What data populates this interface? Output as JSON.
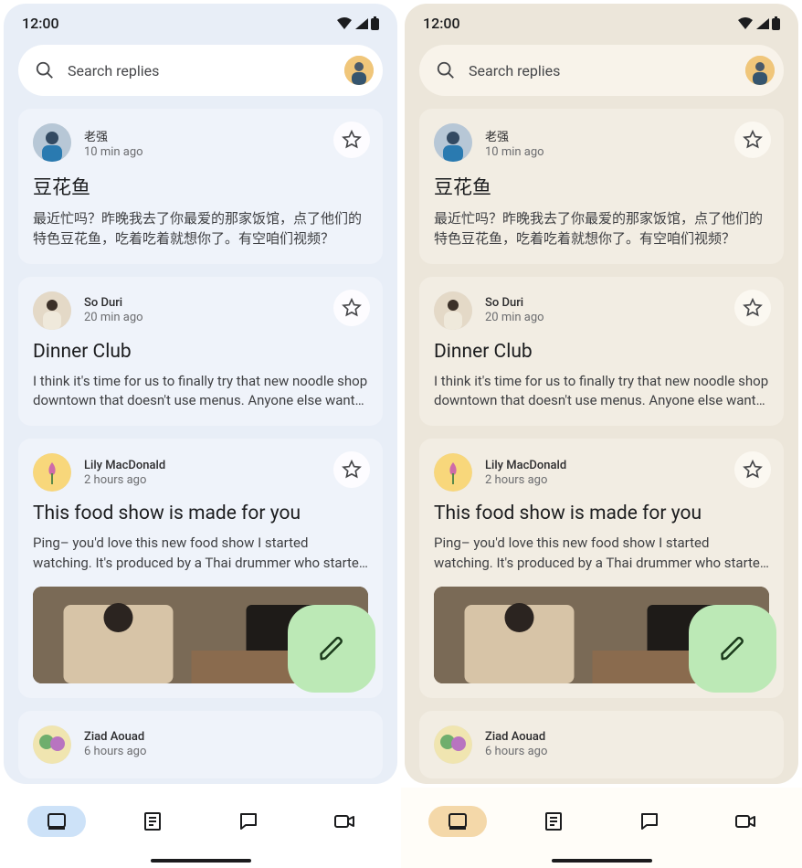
{
  "statusbar": {
    "time": "12:00"
  },
  "search": {
    "placeholder": "Search replies"
  },
  "messages": [
    {
      "sender": "老强",
      "time": "10 min ago",
      "title": "豆花鱼",
      "body": "最近忙吗？昨晚我去了你最爱的那家饭馆，点了他们的特色豆花鱼，吃着吃着就想你了。有空咱们视频？"
    },
    {
      "sender": "So Duri",
      "time": "20 min ago",
      "title": "Dinner Club",
      "body": "I think it's time for us to finally try that new noodle shop downtown that doesn't use menus. Anyone else want to come?"
    },
    {
      "sender": "Lily MacDonald",
      "time": "2 hours ago",
      "title": "This food show is made for you",
      "body": "Ping– you'd love this new food show I started watching. It's produced by a Thai drummer who started cooking."
    },
    {
      "sender": "Ziad Aouad",
      "time": "6 hours ago",
      "title": "",
      "body": ""
    }
  ],
  "nav": {
    "items": [
      "inbox",
      "articles",
      "chat",
      "video"
    ],
    "active_index": 0
  },
  "themes": [
    "blue",
    "beige"
  ]
}
